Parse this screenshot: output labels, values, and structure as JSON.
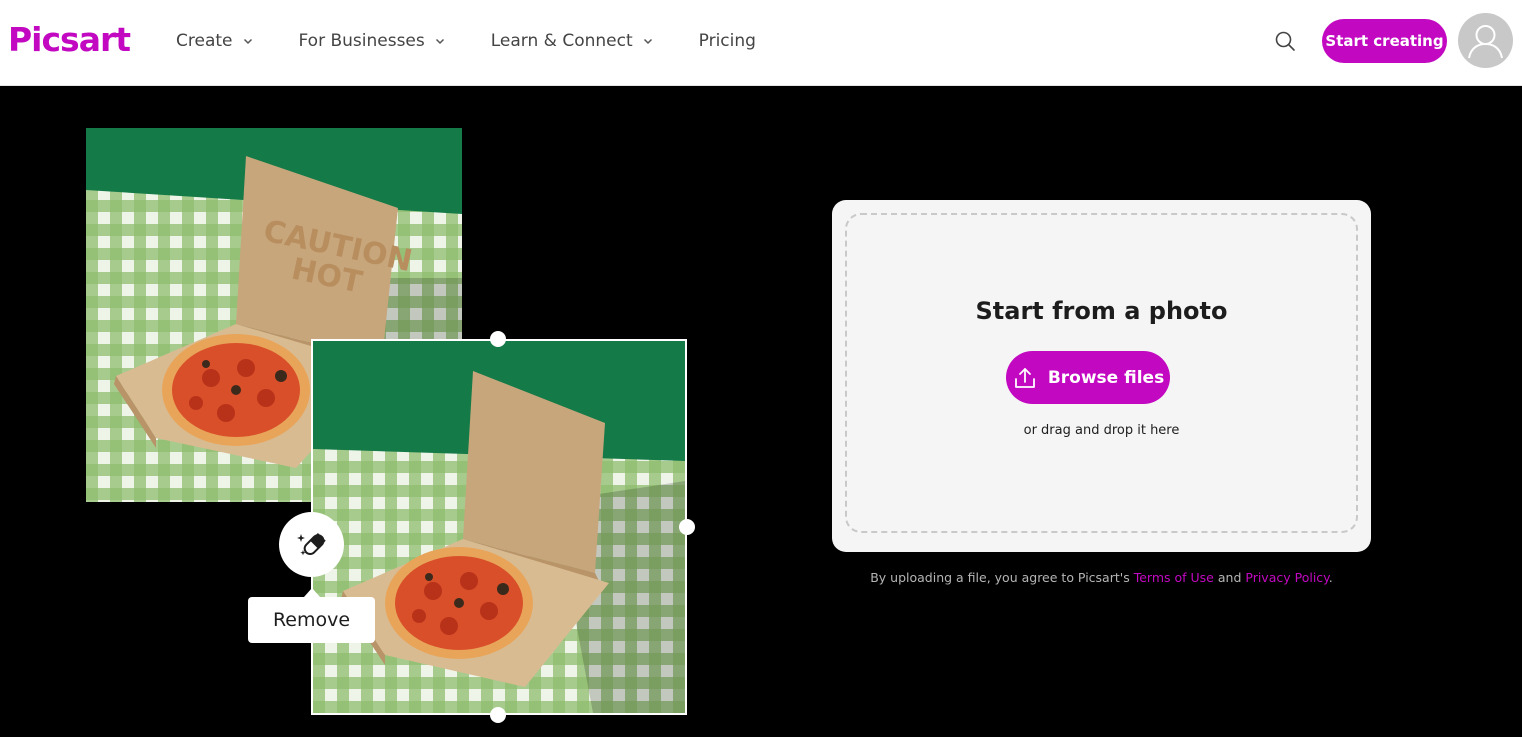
{
  "brand": {
    "logo": "Picsart",
    "accent": "#c209c1"
  },
  "nav": {
    "items": [
      {
        "label": "Create",
        "has_dropdown": true
      },
      {
        "label": "For Businesses",
        "has_dropdown": true
      },
      {
        "label": "Learn & Connect",
        "has_dropdown": true
      },
      {
        "label": "Pricing",
        "has_dropdown": false
      }
    ]
  },
  "header": {
    "search_icon": "search-icon",
    "cta_label": "Start creating",
    "avatar_icon": "user-icon"
  },
  "hero": {
    "tool_icon": "eraser-sparkle-icon",
    "tooltip_label": "Remove"
  },
  "upload": {
    "title": "Start from a photo",
    "browse_label": "Browse files",
    "browse_icon": "upload-icon",
    "drag_text": "or drag and drop it here"
  },
  "legal": {
    "prefix": "By uploading a file, you agree to Picsart's",
    "terms": "Terms of Use",
    "and": "and",
    "privacy": "Privacy Policy",
    "suffix": "."
  }
}
